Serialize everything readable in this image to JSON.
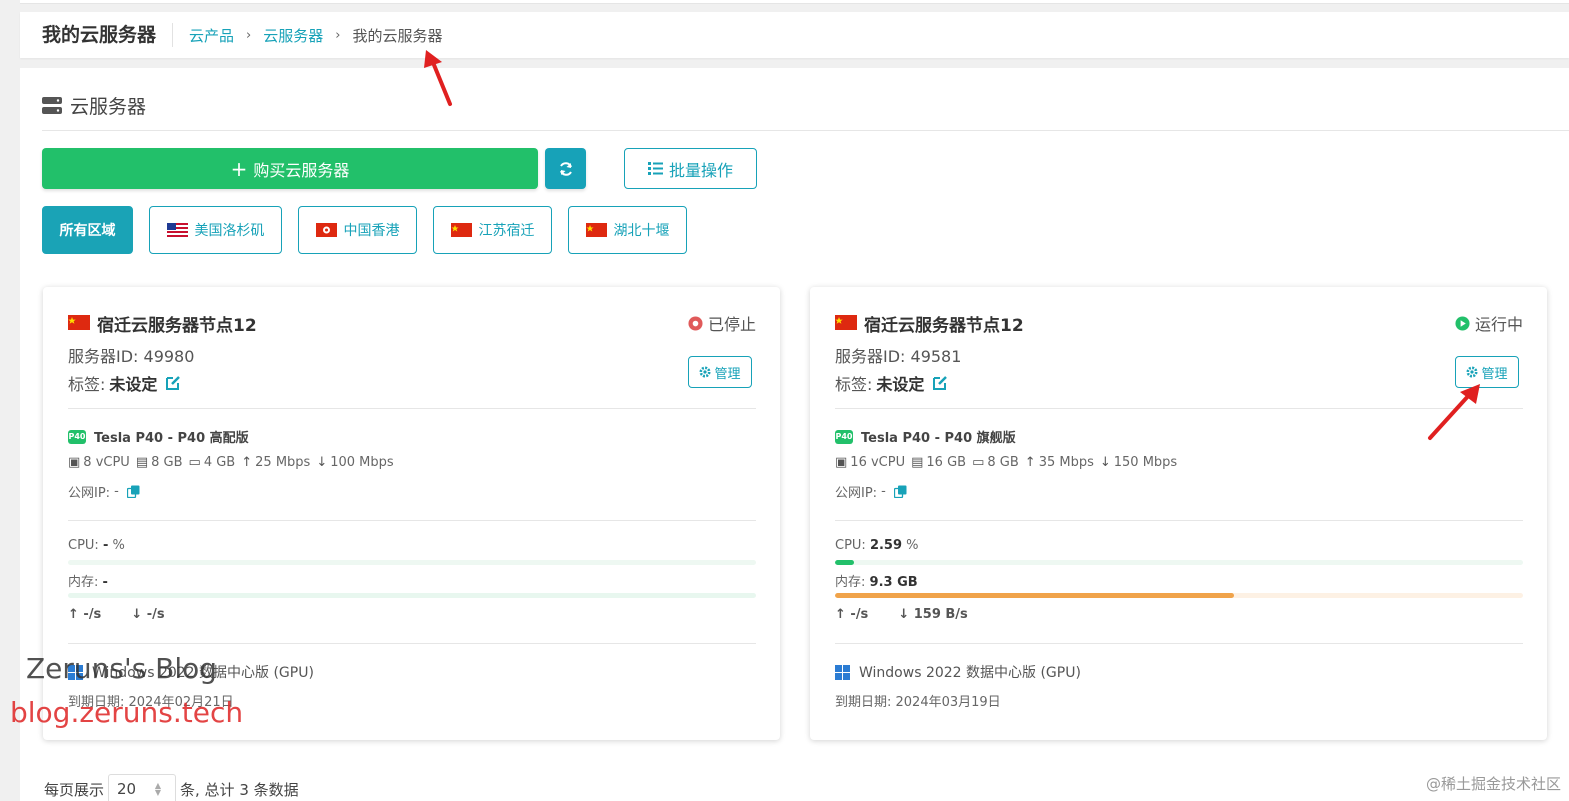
{
  "header": {
    "title": "我的云服务器",
    "breadcrumb": [
      "云产品",
      "云服务器",
      "我的云服务器"
    ]
  },
  "section": {
    "title": "云服务器"
  },
  "toolbar": {
    "buy_label": "购买云服务器",
    "batch_label": "批量操作"
  },
  "regions": [
    {
      "label": "所有区域",
      "active": true
    },
    {
      "label": "美国洛杉矶",
      "flag": "us-flag-icon"
    },
    {
      "label": "中国香港",
      "flag": "hk-flag-icon"
    },
    {
      "label": "江苏宿迁",
      "flag": "cn-flag-icon"
    },
    {
      "label": "湖北十堰",
      "flag": "cn-flag-icon"
    }
  ],
  "servers": [
    {
      "name": "宿迁云服务器节点12",
      "status": "已停止",
      "status_color": "#e05a5a",
      "id_label": "服务器ID: 49980",
      "tag_label": "标签:",
      "tag_value": "未设定",
      "manage_label": "管理",
      "gpu": "Tesla P40 - P40 高配版",
      "gpu_badge": "P40",
      "vcpu": "8 vCPU",
      "ram": "8 GB",
      "disk": "4 GB",
      "up_bw": "25 Mbps",
      "down_bw": "100 Mbps",
      "ip_label": "公网IP:",
      "ip_value": "-",
      "cpu_label": "CPU:",
      "cpu_value": "-",
      "cpu_unit": "%",
      "cpu_fraction": 0,
      "mem_label": "内存:",
      "mem_value": "-",
      "mem_fraction": 0,
      "net_up": "↑ -/s",
      "net_down": "↓ -/s",
      "os": "Windows 2022 数据中心版 (GPU)",
      "expiry": "到期日期: 2024年02月21日"
    },
    {
      "name": "宿迁云服务器节点12",
      "status": "运行中",
      "status_color": "#22c06a",
      "id_label": "服务器ID: 49581",
      "tag_label": "标签:",
      "tag_value": "未设定",
      "manage_label": "管理",
      "gpu": "Tesla P40 - P40 旗舰版",
      "gpu_badge": "P40",
      "vcpu": "16 vCPU",
      "ram": "16 GB",
      "disk": "8 GB",
      "up_bw": "35 Mbps",
      "down_bw": "150 Mbps",
      "ip_label": "公网IP:",
      "ip_value": "-",
      "cpu_label": "CPU:",
      "cpu_value": "2.59",
      "cpu_unit": "%",
      "cpu_fraction": 0.0259,
      "mem_label": "内存:",
      "mem_value": "9.3 GB",
      "mem_fraction": 0.58,
      "net_up": "↑ -/s",
      "net_down": "↓ 159 B/s",
      "os": "Windows 2022 数据中心版 (GPU)",
      "expiry": "到期日期: 2024年03月19日"
    }
  ],
  "pager": {
    "prefix": "每页展示",
    "page_size": "20",
    "suffix": "条, 总计 3 条数据"
  },
  "watermarks": {
    "blog_name": "Zeruns's Blog",
    "blog_url": "blog.zeruns.tech",
    "juejin": "@稀土掘金技术社区"
  },
  "colors": {
    "accent": "#17a2b8",
    "buy_green": "#22c06a",
    "cpu_bar": "#22c06a",
    "mem_bar": "#f0a34a"
  }
}
